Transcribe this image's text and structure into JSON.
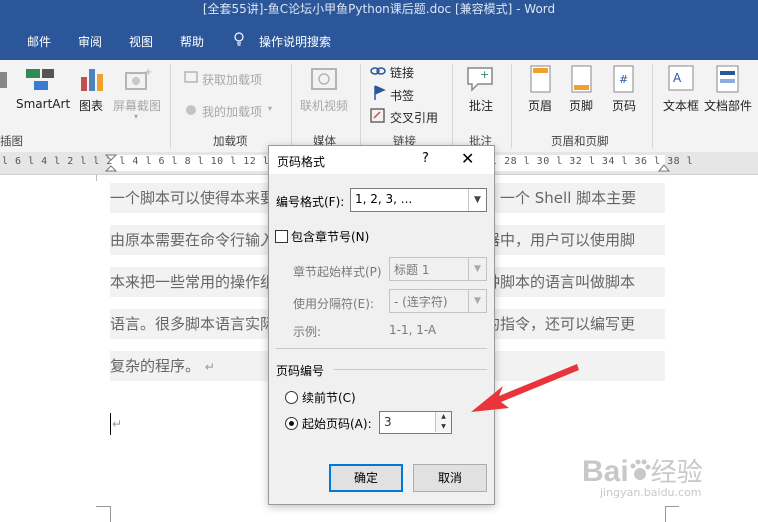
{
  "window": {
    "title": "[全套55讲]-鱼C论坛小甲鱼Python课后题.doc [兼容模式] - Word"
  },
  "tabs": [
    {
      "label": "邮件"
    },
    {
      "label": "审阅"
    },
    {
      "label": "视图"
    },
    {
      "label": "帮助"
    },
    {
      "label": "操作说明搜索"
    }
  ],
  "ribbon": {
    "smartart": "SmartArt",
    "chart": "图表",
    "screenshot": "屏幕截图",
    "get_addins": "获取加载项",
    "my_addins": "我的加载项",
    "online_video": "联机视频",
    "link": "链接",
    "bookmark": "书签",
    "cross_ref": "交叉引用",
    "comment": "批注",
    "header": "页眉",
    "footer": "页脚",
    "page_number": "页码",
    "textbox": "文本框",
    "docparts": "文档部件",
    "groups": {
      "illustrations": "插图",
      "addins": "加载项",
      "media": "媒体",
      "links": "链接",
      "comments": "批注",
      "header_footer": "页眉和页脚"
    }
  },
  "ruler": {
    "text": "l 6 l 4 l 2 l l 2 l 4 l 6 l 8 l 10 l 12 l 14 l 16 l 18 l 20 l 22 l 24 l 26 l 28 l 30 l 32 l 34 l 36 l 38 l"
  },
  "document": {
    "lines": [
      "一个脚本可以使得本来要用键盘进行的相互式操作自动化。一个 Shell 脚本主要",
      "由原本需要在命令行输入的命令组成，或在一个文本编辑器中，用户可以使用脚",
      "本来把一些常用的操作组合成一组串行。主要用来书写这种脚本的语言叫做脚本",
      "语言。很多脚本语言实际上已经超越简单的用户命令串行的指令，还可以编写更",
      "复杂的程序。"
    ],
    "para_mark": "↵",
    "cursor_mark": "↵"
  },
  "dialog": {
    "title": "页码格式",
    "help": "?",
    "close": "✕",
    "number_format_label": "编号格式(F):",
    "number_format_value": "1, 2, 3, ...",
    "include_chapter_label": "包含章节号(N)",
    "include_chapter_checked": false,
    "chapter_style_label": "章节起始样式(P)",
    "chapter_style_value": "标题 1",
    "separator_label": "使用分隔符(E):",
    "separator_value": "- (连字符)",
    "example_label": "示例:",
    "example_value": "1-1, 1-A",
    "page_numbering_label": "页码编号",
    "continue_label": "续前节(C)",
    "start_at_label": "起始页码(A):",
    "start_at_value": "3",
    "selected_option": "start_at",
    "ok": "确定",
    "cancel": "取消"
  },
  "watermark": {
    "brand": "Bai",
    "brand2": "经验",
    "url": "jingyan.baidu.com"
  },
  "colors": {
    "accent": "#2b579a",
    "arrow": "#e8343a",
    "default_button": "#0078d7"
  }
}
